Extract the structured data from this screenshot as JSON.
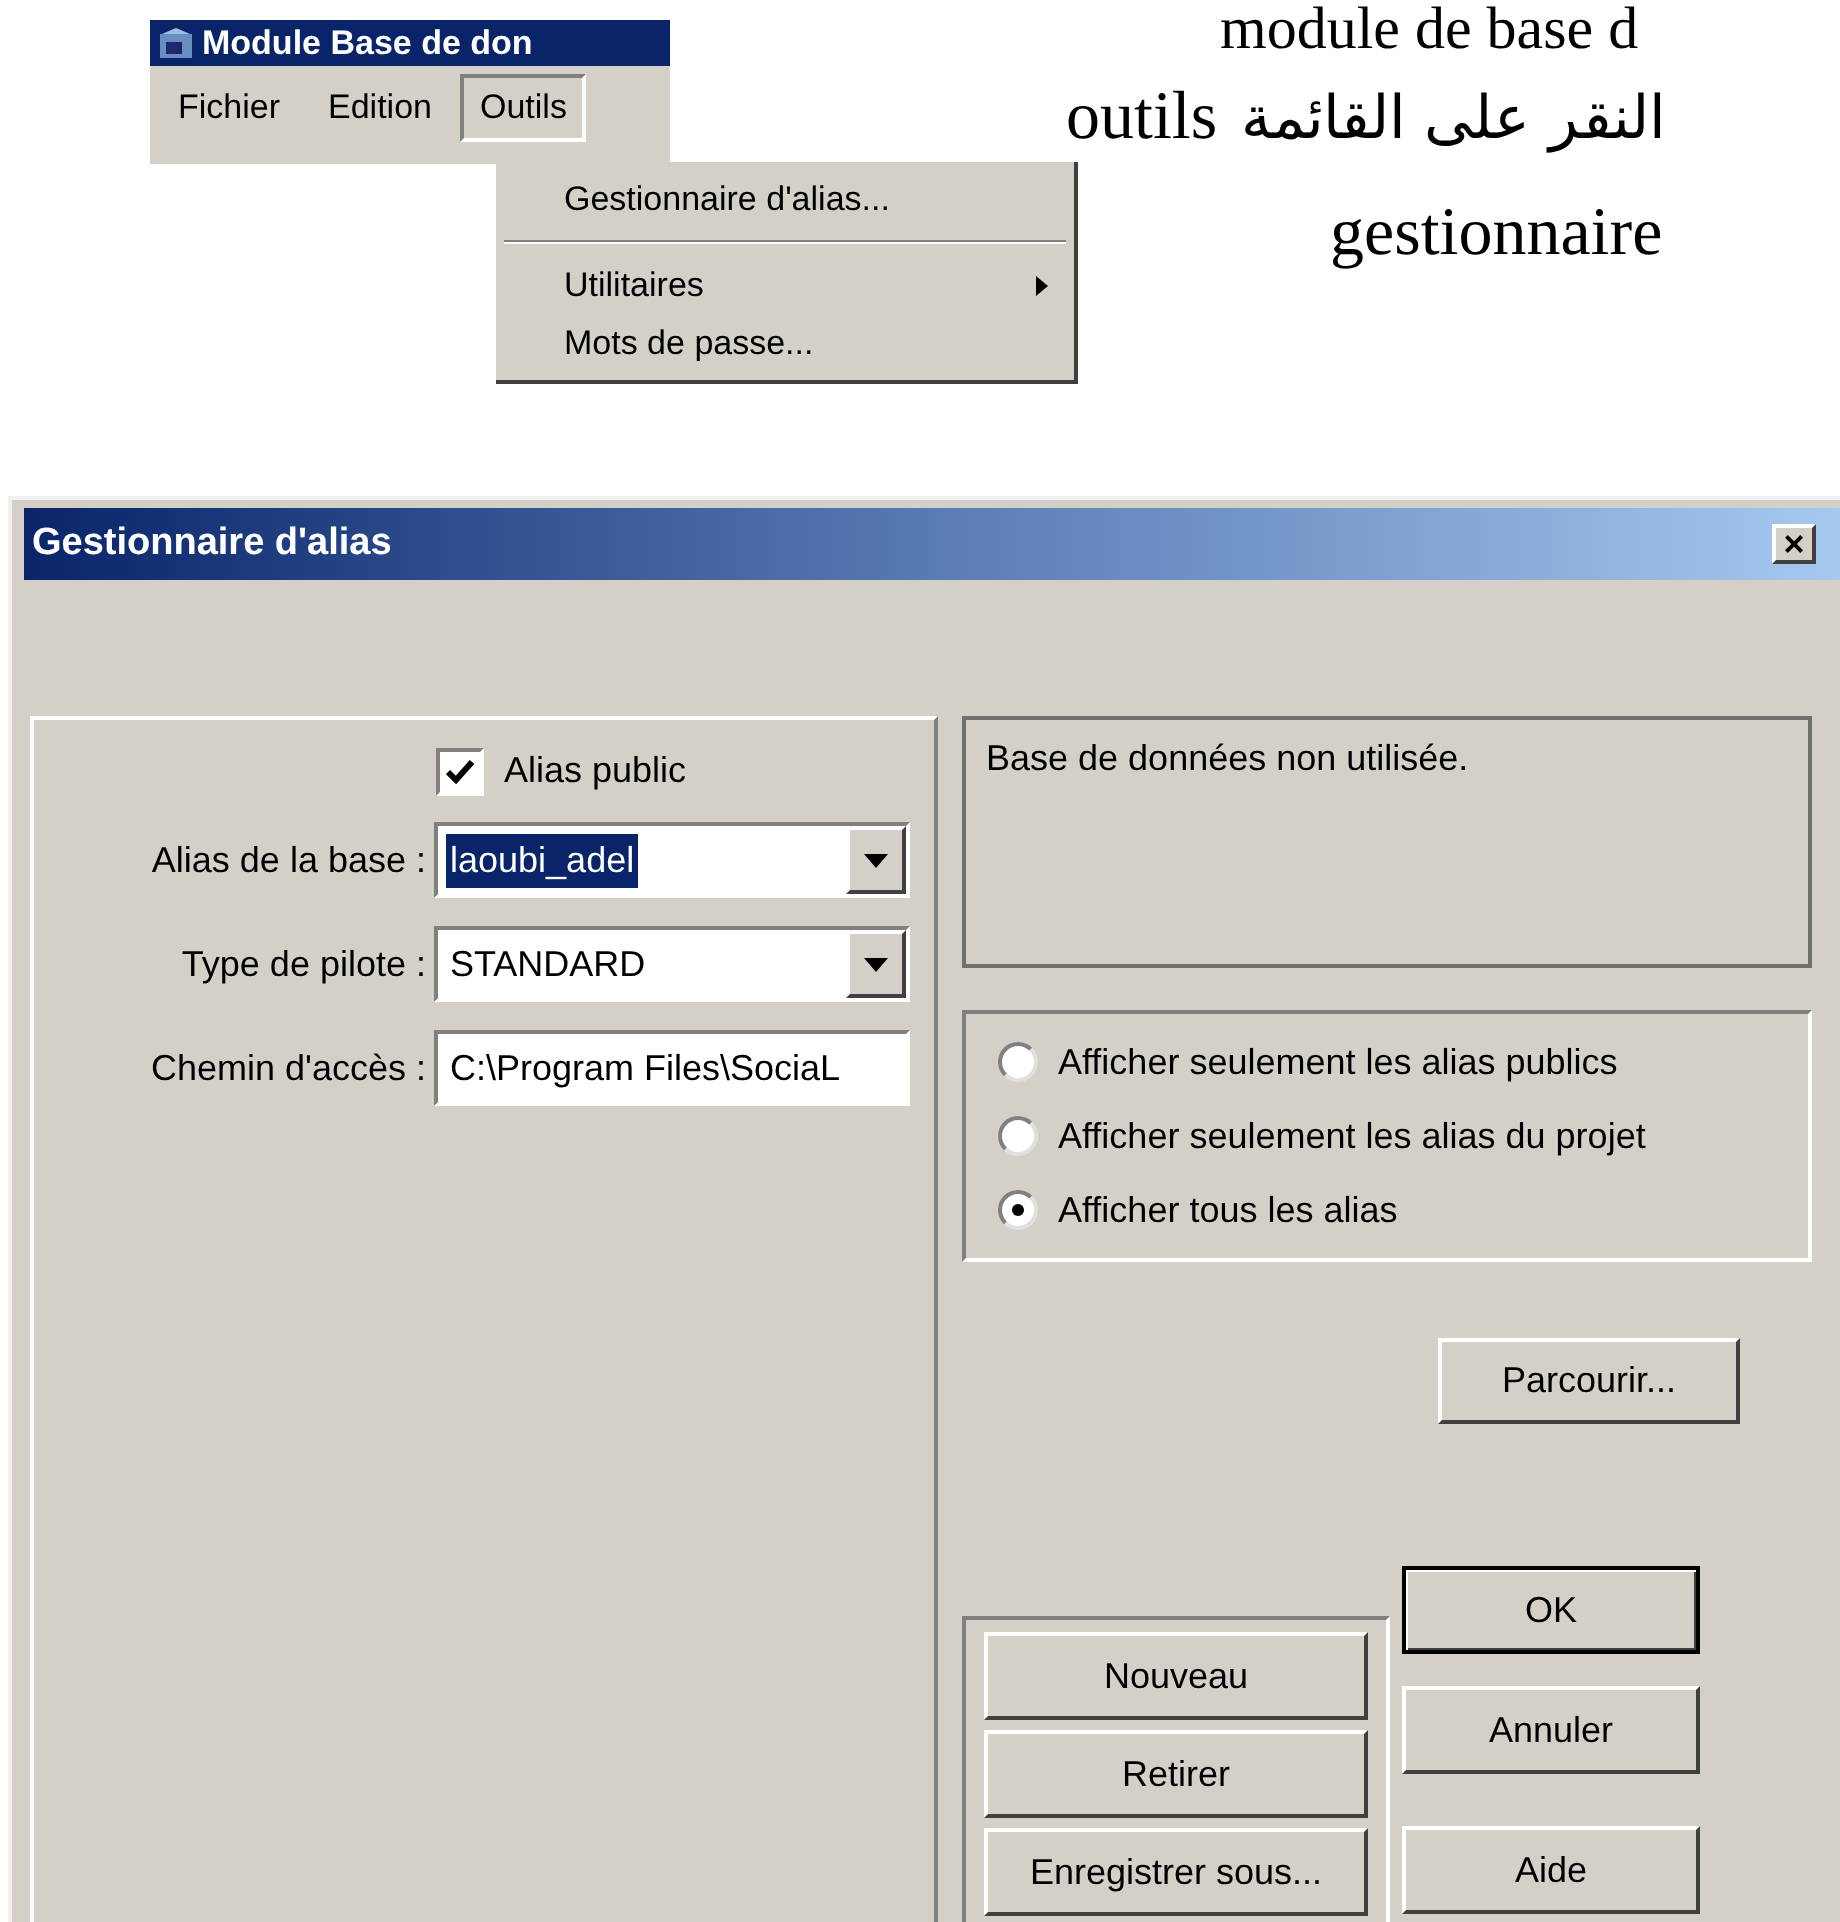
{
  "document_text": {
    "line_1": "module de base d",
    "line_2_latin": "outils",
    "line_2_arabic": "النقر على القائمة",
    "line_3": "gestionnaire"
  },
  "app_window": {
    "title": "Module Base de don",
    "menu": [
      {
        "label": "Fichier",
        "selected": false
      },
      {
        "label": "Edition",
        "selected": false
      },
      {
        "label": "Outils",
        "selected": true
      }
    ]
  },
  "dropdown_menu": [
    {
      "kind": "item",
      "label": "Gestionnaire d'alias...",
      "has_submenu": false
    },
    {
      "kind": "separator"
    },
    {
      "kind": "item",
      "label": "Utilitaires",
      "has_submenu": true
    },
    {
      "kind": "item",
      "label": "Mots de passe...",
      "has_submenu": false
    }
  ],
  "dialog": {
    "title": "Gestionnaire d'alias",
    "close": "×",
    "alias_public": {
      "label": "Alias public",
      "checked": true
    },
    "fields": [
      {
        "kind": "combo",
        "label": "Alias de la base :",
        "value": "laoubi_adel",
        "highlighted": true
      },
      {
        "kind": "combo",
        "label": "Type de pilote :",
        "value": "STANDARD",
        "highlighted": false
      },
      {
        "kind": "text",
        "label": "Chemin d'accès :",
        "value": "C:\\Program Files\\SociaL",
        "highlighted": false
      }
    ],
    "status": "Base de données non utilisée.",
    "filter_options": [
      {
        "label": "Afficher seulement les alias publics",
        "selected": false
      },
      {
        "label": "Afficher seulement les alias du projet",
        "selected": false
      },
      {
        "label": "Afficher tous les alias",
        "selected": true
      }
    ],
    "browse_button": "Parcourir...",
    "alias_buttons": [
      "Nouveau",
      "Retirer",
      "Enregistrer sous..."
    ],
    "dialog_buttons": [
      {
        "label": "OK",
        "default": true
      },
      {
        "label": "Annuler",
        "default": false
      },
      {
        "label": "Aide",
        "default": false
      }
    ]
  }
}
